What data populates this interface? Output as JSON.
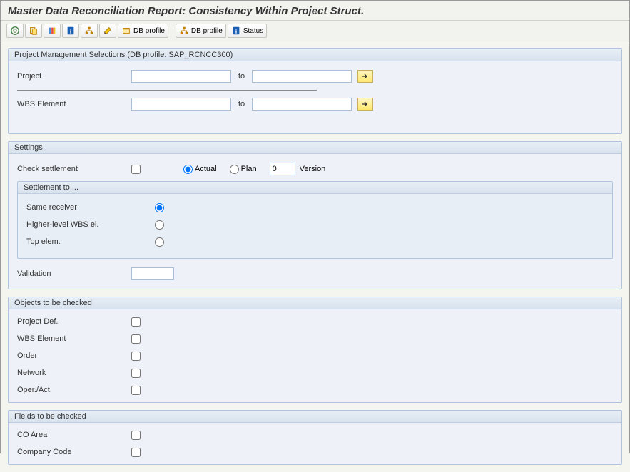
{
  "title": "Master Data Reconciliation Report: Consistency Within Project Struct.",
  "toolbar": {
    "db_profile_btn": "DB profile",
    "db_profile_menu": "DB profile",
    "status_menu": "Status"
  },
  "groups": {
    "proj_sel": {
      "title": "Project Management Selections (DB profile: SAP_RCNCC300)",
      "project_label": "Project",
      "wbs_label": "WBS Element",
      "to": "to",
      "project_from": "",
      "project_to": "",
      "wbs_from": "",
      "wbs_to": ""
    },
    "settings": {
      "title": "Settings",
      "check_settlement": "Check settlement",
      "actual": "Actual",
      "plan": "Plan",
      "version_label": "Version",
      "version_value": "0",
      "settlement_to": "Settlement to ...",
      "same_receiver": "Same receiver",
      "higher_level": "Higher-level WBS el.",
      "top_elem": "Top elem.",
      "validation": "Validation",
      "validation_value": ""
    },
    "objects": {
      "title": "Objects to be checked",
      "proj_def": "Project Def.",
      "wbs_element": "WBS Element",
      "order": "Order",
      "network": "Network",
      "oper_act": "Oper./Act."
    },
    "fields": {
      "title": "Fields to be checked",
      "co_area": "CO Area",
      "company_code": "Company Code"
    }
  }
}
